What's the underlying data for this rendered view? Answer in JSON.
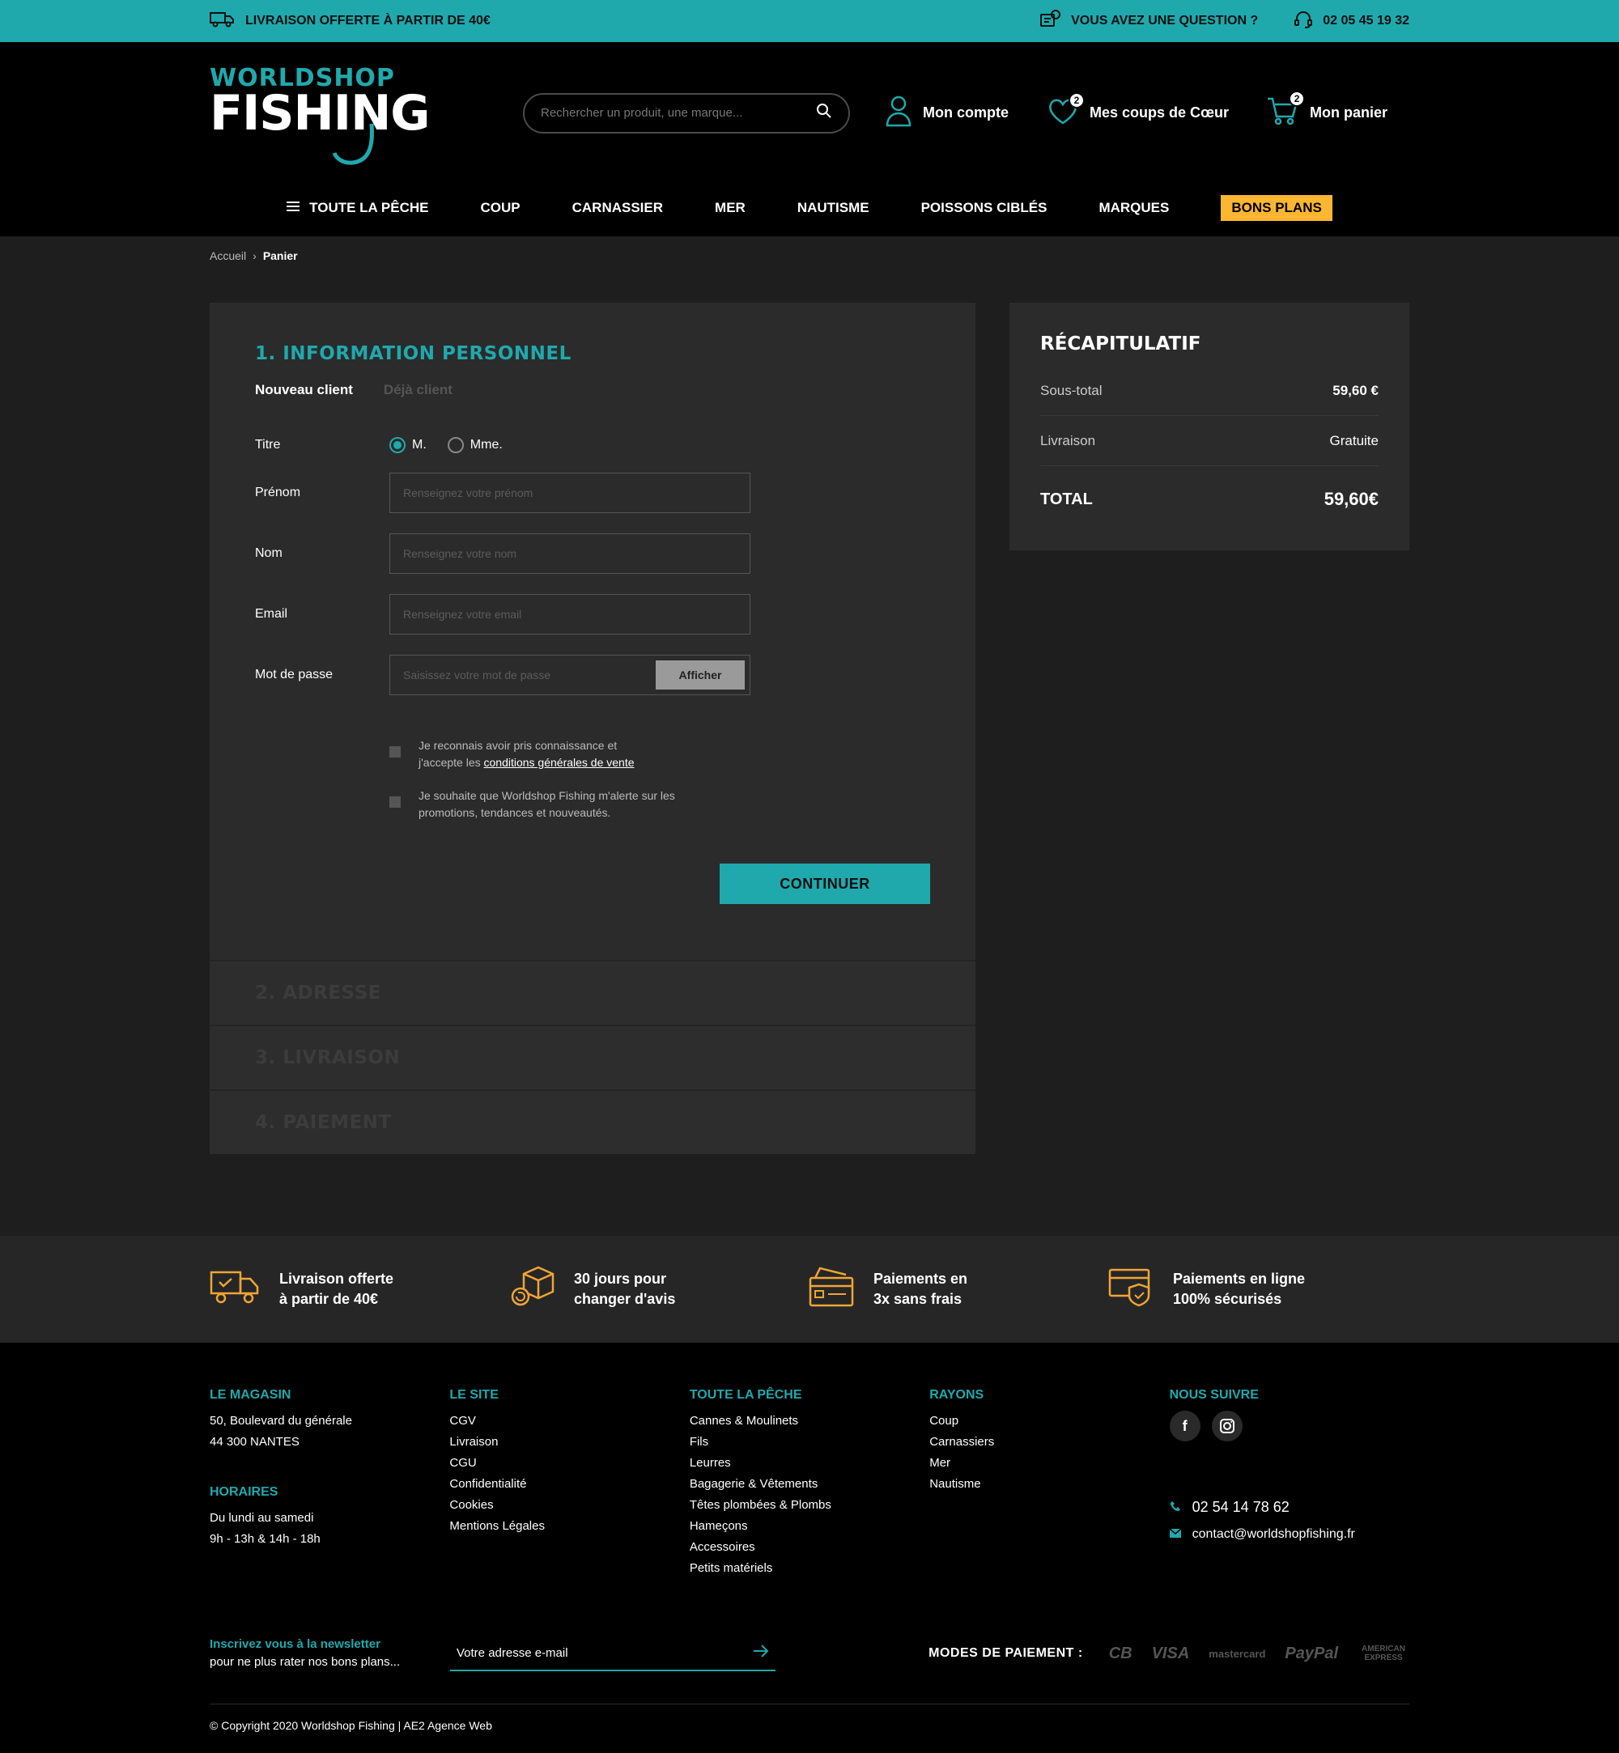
{
  "topbar": {
    "shipping": "LIVRAISON OFFERTE À PARTIR DE 40€",
    "question": "VOUS AVEZ UNE QUESTION ?",
    "phone": "02 05 45 19 32"
  },
  "header": {
    "logo_top": "WORLDSHOP",
    "logo_bottom": "FISHING",
    "search_placeholder": "Rechercher un produit, une marque...",
    "account": "Mon compte",
    "wishlist": "Mes coups de Cœur",
    "wishlist_count": "2",
    "cart": "Mon panier",
    "cart_count": "2"
  },
  "nav": [
    "TOUTE LA PÊCHE",
    "COUP",
    "CARNASSIER",
    "MER",
    "NAUTISME",
    "POISSONS CIBLÉS",
    "MARQUES",
    "BONS PLANS"
  ],
  "breadcrumb": {
    "home": "Accueil",
    "sep": "›",
    "current": "Panier"
  },
  "checkout": {
    "step1_title": "1. INFORMATION PERSONNEL",
    "tab_new": "Nouveau client",
    "tab_existing": "Déjà client",
    "title_label": "Titre",
    "title_m": "M.",
    "title_mme": "Mme.",
    "firstname_label": "Prénom",
    "firstname_placeholder": "Renseignez votre prénom",
    "lastname_label": "Nom",
    "lastname_placeholder": "Renseignez votre nom",
    "email_label": "Email",
    "email_placeholder": "Renseignez votre email",
    "password_label": "Mot de passe",
    "password_placeholder": "Saisissez votre mot de passe",
    "show_label": "Afficher",
    "cgv_text_1": "Je reconnais avoir pris connaissance et",
    "cgv_text_2": "j'accepte les",
    "cgv_link": "conditions générales de vente",
    "news_text_1": "Je souhaite que Worldshop Fishing m'alerte sur les",
    "news_text_2": "promotions, tendances et nouveautés.",
    "continue": "CONTINUER",
    "step2": "2. ADRESSE",
    "step3": "3. LIVRAISON",
    "step4": "4. PAIEMENT"
  },
  "recap": {
    "title": "RÉCAPITULATIF",
    "subtotal_label": "Sous-total",
    "subtotal": "59,60 €",
    "shipping_label": "Livraison",
    "shipping": "Gratuite",
    "total_label": "TOTAL",
    "total": "59,60€"
  },
  "reassurance": [
    {
      "l1": "Livraison offerte",
      "l2": "à partir de 40€"
    },
    {
      "l1": "30 jours pour",
      "l2": "changer d'avis"
    },
    {
      "l1": "Paiements en",
      "l2": "3x sans frais"
    },
    {
      "l1": "Paiements en ligne",
      "l2": "100% sécurisés"
    }
  ],
  "footer": {
    "store_title": "LE MAGASIN",
    "address1": "50, Boulevard du générale",
    "address2": "44 300 NANTES",
    "hours_title": "HORAIRES",
    "hours1": "Du lundi au samedi",
    "hours2": "9h - 13h & 14h - 18h",
    "site_title": "LE SITE",
    "site_links": [
      "CGV",
      "Livraison",
      "CGU",
      "Confidentialité",
      "Cookies",
      "Mentions Légales"
    ],
    "fishing_title": "TOUTE LA PÊCHE",
    "fishing_links": [
      "Cannes & Moulinets",
      "Fils",
      "Leurres",
      "Bagagerie & Vêtements",
      "Têtes plombées & Plombs",
      "Hameçons",
      "Accessoires",
      "Petits matériels"
    ],
    "rayons_title": "RAYONS",
    "rayons_links": [
      "Coup",
      "Carnassiers",
      "Mer",
      "Nautisme"
    ],
    "follow_title": "NOUS SUIVRE",
    "facebook": "f",
    "phone": "02 54 14 78 62",
    "email": "contact@worldshopfishing.fr",
    "newsletter_title": "Inscrivez vous à la newsletter",
    "newsletter_sub": "pour ne plus rater nos bons plans...",
    "newsletter_placeholder": "Votre adresse e-mail",
    "payment_label": "MODES DE PAIEMENT :",
    "payment_logos": [
      "CB",
      "VISA",
      "mastercard",
      "PayPal",
      "AMERICAN EXPRESS"
    ],
    "copyright": "© Copyright 2020 Worldshop Fishing | AE2 Agence Web"
  },
  "colors": {
    "accent": "#1fa9ad",
    "promo": "#fdb631",
    "icon_orange": "#f0a535"
  }
}
